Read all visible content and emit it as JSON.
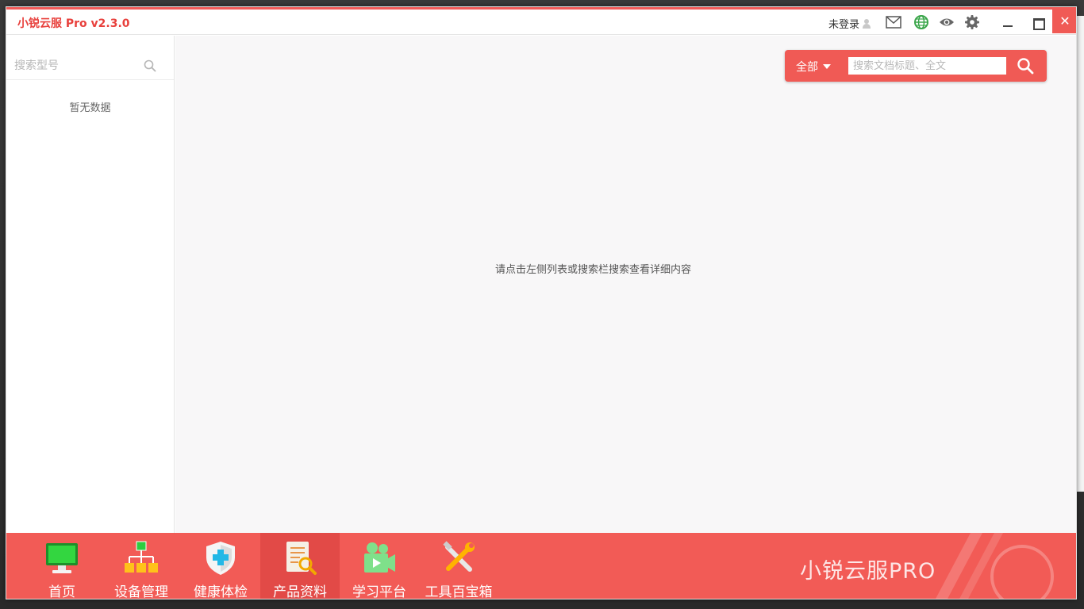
{
  "window": {
    "title": "小锐云服 Pro v2.3.0",
    "login_text": "未登录",
    "close_glyph": "✕"
  },
  "icons": {
    "mail": "mail-icon",
    "network": "globe-icon",
    "view": "eye-icon",
    "settings": "gear-icon"
  },
  "sidebar": {
    "search_placeholder": "搜索型号",
    "empty_text": "暂无数据"
  },
  "main": {
    "scope_label": "全部",
    "search_placeholder": "搜索文档标题、全文",
    "hint": "请点击左侧列表或搜索栏搜索查看详细内容"
  },
  "nav": {
    "items": [
      {
        "label": "首页",
        "icon": "monitor-icon"
      },
      {
        "label": "设备管理",
        "icon": "network-tree-icon"
      },
      {
        "label": "健康体检",
        "icon": "shield-plus-icon"
      },
      {
        "label": "产品资料",
        "icon": "document-search-icon",
        "active": true
      },
      {
        "label": "学习平台",
        "icon": "video-camera-icon"
      },
      {
        "label": "工具百宝箱",
        "icon": "tools-icon"
      }
    ],
    "brand": "小锐云服PRO"
  },
  "colors": {
    "accent": "#f25b56",
    "active_nav": "#e24a47",
    "title_red": "#e8403c"
  }
}
